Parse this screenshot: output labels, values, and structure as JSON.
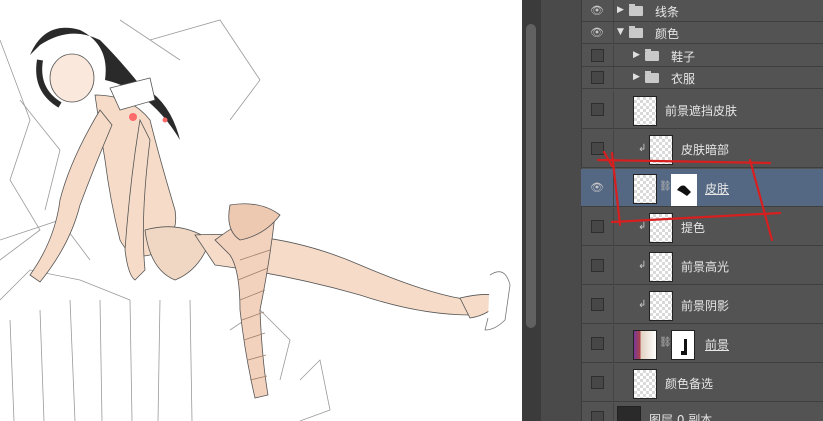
{
  "layers": {
    "group_lines": {
      "name": "线条",
      "visible": true,
      "expanded": false
    },
    "group_color": {
      "name": "颜色",
      "visible": true,
      "expanded": true
    },
    "group_shoes": {
      "name": "鞋子",
      "visible": false,
      "expanded": false
    },
    "group_clothes": {
      "name": "衣服",
      "visible": false,
      "expanded": false
    },
    "fg_occlude_skin": {
      "name": "前景遮挡皮肤"
    },
    "skin_dark": {
      "name": "皮肤暗部"
    },
    "skin": {
      "name": "皮肤"
    },
    "tint": {
      "name": "提色"
    },
    "fg_highlight": {
      "name": "前景高光"
    },
    "fg_shadow": {
      "name": "前景阴影"
    },
    "foreground": {
      "name": "前景"
    },
    "color_alt": {
      "name": "颜色备选"
    },
    "layer_copy": {
      "name": "图层 0 副本"
    }
  },
  "colors": {
    "panel_bg": "#535353",
    "selected_row": "#556883",
    "annotation_red": "#d81f1f",
    "skin_tone": "#f6dcc8"
  },
  "icons": [
    "eye-icon",
    "folder-icon",
    "chain-link-icon",
    "clip-arrow-icon",
    "expand-triangle-icon"
  ]
}
